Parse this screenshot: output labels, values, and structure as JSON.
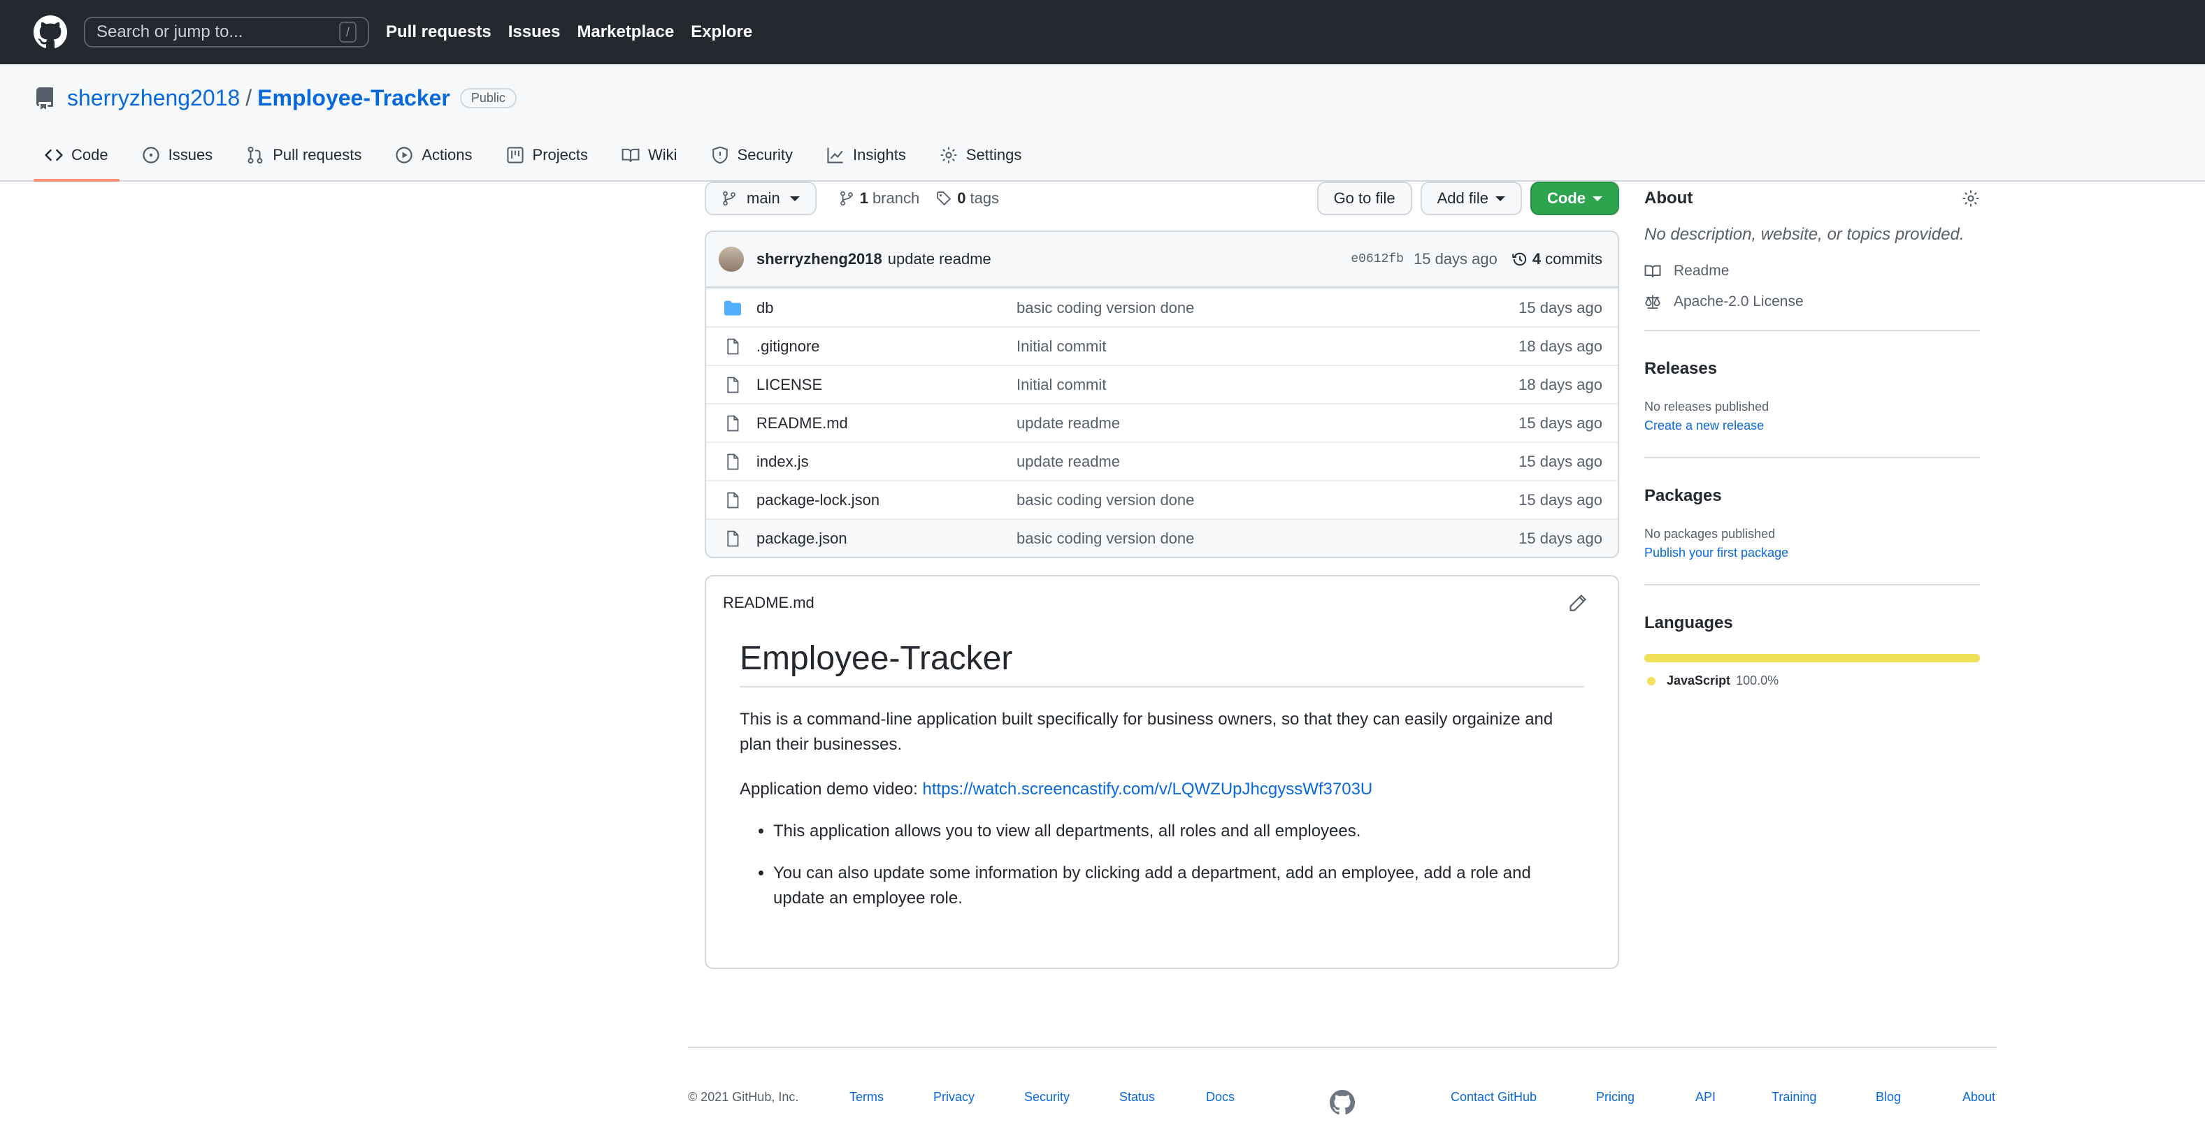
{
  "header": {
    "search_placeholder": "Search or jump to...",
    "slash_key": "/",
    "nav": [
      "Pull requests",
      "Issues",
      "Marketplace",
      "Explore"
    ]
  },
  "repo": {
    "owner": "sherryzheng2018",
    "separator": "/",
    "name": "Employee-Tracker",
    "visibility": "Public"
  },
  "tabs": [
    {
      "label": "Code",
      "icon": "code-icon"
    },
    {
      "label": "Issues",
      "icon": "issue-icon"
    },
    {
      "label": "Pull requests",
      "icon": "pull-request-icon"
    },
    {
      "label": "Actions",
      "icon": "play-icon"
    },
    {
      "label": "Projects",
      "icon": "project-icon"
    },
    {
      "label": "Wiki",
      "icon": "book-icon"
    },
    {
      "label": "Security",
      "icon": "shield-icon"
    },
    {
      "label": "Insights",
      "icon": "graph-icon"
    },
    {
      "label": "Settings",
      "icon": "gear-icon"
    }
  ],
  "file_nav": {
    "branch": "main",
    "branch_count": "1",
    "branch_label": "branch",
    "tag_count": "0",
    "tag_label": "tags",
    "go_to_file": "Go to file",
    "add_file": "Add file",
    "code": "Code"
  },
  "commit": {
    "author": "sherryzheng2018",
    "message": "update readme",
    "sha": "e0612fb",
    "age": "15 days ago",
    "count": "4",
    "count_label": "commits"
  },
  "files": [
    {
      "name": "db",
      "type": "dir",
      "message": "basic coding version done",
      "age": "15 days ago"
    },
    {
      "name": ".gitignore",
      "type": "file",
      "message": "Initial commit",
      "age": "18 days ago"
    },
    {
      "name": "LICENSE",
      "type": "file",
      "message": "Initial commit",
      "age": "18 days ago"
    },
    {
      "name": "README.md",
      "type": "file",
      "message": "update readme",
      "age": "15 days ago"
    },
    {
      "name": "index.js",
      "type": "file",
      "message": "update readme",
      "age": "15 days ago"
    },
    {
      "name": "package-lock.json",
      "type": "file",
      "message": "basic coding version done",
      "age": "15 days ago"
    },
    {
      "name": "package.json",
      "type": "file",
      "message": "basic coding version done",
      "age": "15 days ago"
    }
  ],
  "readme": {
    "filename": "README.md",
    "title": "Employee-Tracker",
    "para1": "This is a command-line application built specifically for business owners, so that they can easily orgainize and plan their businesses.",
    "demo_label": "Application demo video: ",
    "demo_link": "https://watch.screencastify.com/v/LQWZUpJhcgyssWf3703U",
    "bullets": [
      "This application allows you to view all departments, all roles and all employees.",
      "You can also update some information by clicking add a department, add an employee, add a role and update an employee role."
    ]
  },
  "sidebar": {
    "about_title": "About",
    "about_desc": "No description, website, or topics provided.",
    "readme_link": "Readme",
    "license_link": "Apache-2.0 License",
    "releases_title": "Releases",
    "releases_none": "No releases published",
    "releases_create": "Create a new release",
    "packages_title": "Packages",
    "packages_none": "No packages published",
    "packages_publish": "Publish your first package",
    "languages_title": "Languages",
    "language_name": "JavaScript",
    "language_pct": "100.0%",
    "language_fraction": 1.0,
    "language_color": "#f1e05a"
  },
  "footer": {
    "copyright": "© 2021 GitHub, Inc.",
    "links": [
      "Terms",
      "Privacy",
      "Security",
      "Status",
      "Docs",
      "Contact GitHub",
      "Pricing",
      "API",
      "Training",
      "Blog",
      "About"
    ]
  },
  "colors": {
    "accent_link": "#0969da",
    "code_button": "#2da44e",
    "tab_underline": "#fd8c73",
    "folder": "#54aeff"
  }
}
